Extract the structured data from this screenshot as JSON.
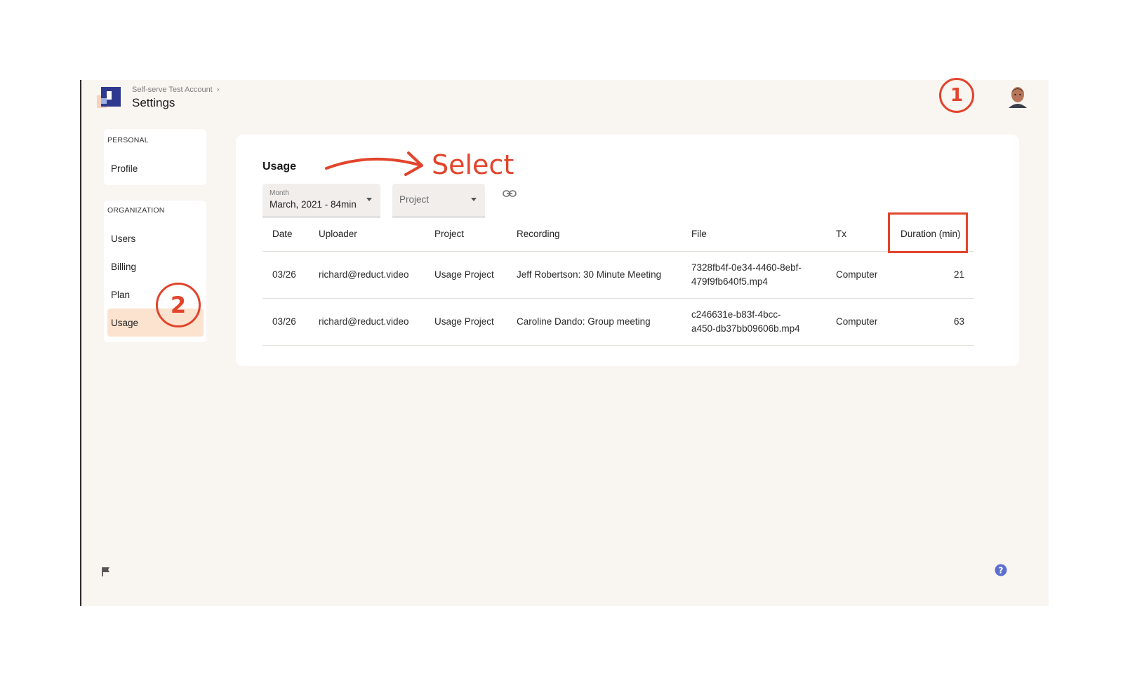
{
  "header": {
    "breadcrumb": "Self-serve Test Account",
    "breadcrumb_separator": "›",
    "title": "Settings"
  },
  "sidebar": {
    "personal_heading": "PERSONAL",
    "personal_items": [
      {
        "label": "Profile"
      }
    ],
    "organization_heading": "ORGANIZATION",
    "organization_items": [
      {
        "label": "Users"
      },
      {
        "label": "Billing"
      },
      {
        "label": "Plan"
      },
      {
        "label": "Usage",
        "active": true
      }
    ]
  },
  "main": {
    "title": "Usage",
    "month_select": {
      "label": "Month",
      "value": "March, 2021 - 84min"
    },
    "project_select": {
      "placeholder": "Project"
    },
    "table": {
      "headers": [
        "Date",
        "Uploader",
        "Project",
        "Recording",
        "File",
        "Tx",
        "Duration (min)"
      ],
      "rows": [
        {
          "date": "03/26",
          "uploader": "richard@reduct.video",
          "project": "Usage Project",
          "recording": "Jeff Robertson: 30 Minute Meeting",
          "file_line1": "7328fb4f-0e34-4460-8ebf-",
          "file_line2": "479f9fb640f5.mp4",
          "tx": "Computer",
          "duration": "21"
        },
        {
          "date": "03/26",
          "uploader": "richard@reduct.video",
          "project": "Usage Project",
          "recording": "Caroline Dando: Group meeting",
          "file_line1": "c246631e-b83f-4bcc-",
          "file_line2": "a450-db37bb09606b.mp4",
          "tx": "Computer",
          "duration": "63"
        }
      ]
    }
  },
  "annotations": {
    "select_text": "Select",
    "badge_1": "1",
    "badge_2": "2",
    "color": "#e2442c"
  },
  "icons": {
    "logo": "reduct-logo",
    "link": "link-icon",
    "flag": "flag-icon",
    "help": "help-icon",
    "avatar": "user-avatar"
  },
  "colors": {
    "app_background": "#f9f5f1",
    "active_nav": "#fce3cf",
    "help_icon": "#5b6fd1",
    "logo_blue": "#2f3a8f"
  }
}
